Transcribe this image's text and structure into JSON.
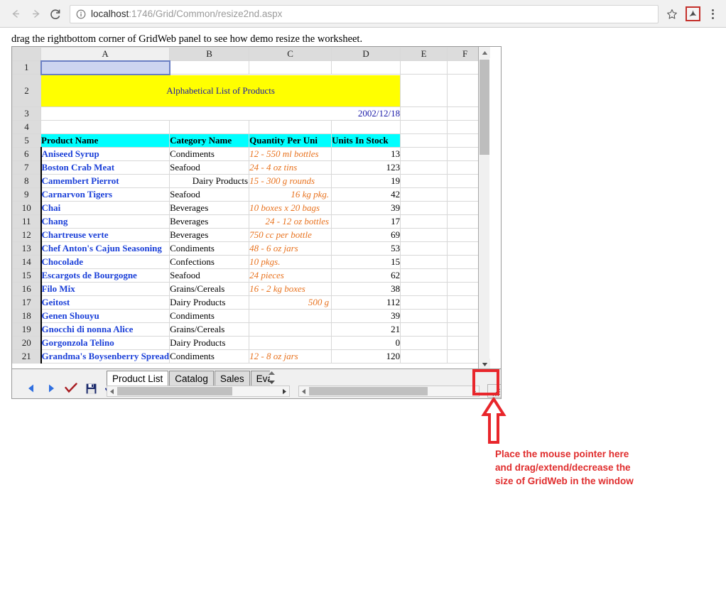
{
  "browser": {
    "back_icon": "arrow-left-icon",
    "forward_icon": "arrow-right-icon",
    "reload_icon": "reload-icon",
    "info_icon": "info-circle-icon",
    "url_host": "localhost",
    "url_path": ":1746/Grid/Common/resize2nd.aspx",
    "url_full": "localhost:1746/Grid/Common/resize2nd.aspx",
    "star_icon": "star-bookmark-icon",
    "extension_icon": "adobe-pdf-extension-icon",
    "menu_icon": "kebab-menu-icon"
  },
  "page": {
    "note": "drag the rightbottom corner of GridWeb panel to see how demo resize the worksheet."
  },
  "grid": {
    "columns": [
      "A",
      "B",
      "C",
      "D",
      "E",
      "F"
    ],
    "selected_cell": "A1",
    "title_banner": "Alphabetical List of Products",
    "date": "2002/12/18",
    "headers": [
      "Product Name",
      "Category Name",
      "Quantity Per Uni",
      "Units In Stock"
    ],
    "rows": [
      {
        "n": "6",
        "product": "Aniseed Syrup",
        "category": "Condiments",
        "cat_align": "left",
        "qty": "12 - 550 ml bottles",
        "qty_align": "left",
        "stock": "13"
      },
      {
        "n": "7",
        "product": "Boston Crab Meat",
        "category": "Seafood",
        "cat_align": "left",
        "qty": "24 - 4 oz tins",
        "qty_align": "left",
        "stock": "123"
      },
      {
        "n": "8",
        "product": "Camembert Pierrot",
        "category": "Dairy Products",
        "cat_align": "right",
        "qty": "15 - 300 g rounds",
        "qty_align": "left",
        "stock": "19"
      },
      {
        "n": "9",
        "product": "Carnarvon Tigers",
        "category": "Seafood",
        "cat_align": "left",
        "qty": "16 kg pkg.",
        "qty_align": "right",
        "stock": "42"
      },
      {
        "n": "10",
        "product": "Chai",
        "category": "Beverages",
        "cat_align": "left",
        "qty": "10 boxes x 20 bags",
        "qty_align": "left",
        "stock": "39"
      },
      {
        "n": "11",
        "product": "Chang",
        "category": "Beverages",
        "cat_align": "left",
        "qty": "24 - 12 oz bottles",
        "qty_align": "right",
        "stock": "17"
      },
      {
        "n": "12",
        "product": "Chartreuse verte",
        "category": "Beverages",
        "cat_align": "left",
        "qty": "750 cc per bottle",
        "qty_align": "left",
        "stock": "69"
      },
      {
        "n": "13",
        "product": "Chef Anton's Cajun Seasoning",
        "category": "Condiments",
        "cat_align": "left",
        "qty": "48 - 6 oz jars",
        "qty_align": "left",
        "stock": "53"
      },
      {
        "n": "14",
        "product": "Chocolade",
        "category": "Confections",
        "cat_align": "left",
        "qty": "10 pkgs.",
        "qty_align": "left",
        "stock": "15"
      },
      {
        "n": "15",
        "product": "Escargots de Bourgogne",
        "category": "Seafood",
        "cat_align": "left",
        "qty": "24 pieces",
        "qty_align": "left",
        "stock": "62"
      },
      {
        "n": "16",
        "product": "Filo Mix",
        "category": "Grains/Cereals",
        "cat_align": "left",
        "qty": "16 - 2 kg boxes",
        "qty_align": "left",
        "stock": "38"
      },
      {
        "n": "17",
        "product": "Geitost",
        "category": "Dairy Products",
        "cat_align": "left",
        "qty": "500 g",
        "qty_align": "right",
        "stock": "112"
      },
      {
        "n": "18",
        "product": "Genen Shouyu",
        "category": "Condiments",
        "cat_align": "left",
        "qty": "",
        "qty_align": "left",
        "stock": "39"
      },
      {
        "n": "19",
        "product": "Gnocchi di nonna Alice",
        "category": "Grains/Cereals",
        "cat_align": "left",
        "qty": "",
        "qty_align": "left",
        "stock": "21"
      },
      {
        "n": "20",
        "product": "Gorgonzola Telino",
        "category": "Dairy Products",
        "cat_align": "left",
        "qty": "",
        "qty_align": "left",
        "stock": "0"
      },
      {
        "n": "21",
        "product": "Grandma's Boysenberry Spread",
        "category": "Condiments",
        "cat_align": "left",
        "qty": "12 - 8 oz jars",
        "qty_align": "left",
        "stock": "120"
      }
    ]
  },
  "toolbar": {
    "prev_icon": "triangle-left-icon",
    "next_icon": "triangle-right-icon",
    "submit_icon": "checkmark-icon",
    "save_icon": "floppy-save-icon",
    "undo_icon": "undo-arrow-icon"
  },
  "tabs": [
    {
      "label": "Product List",
      "active": true
    },
    {
      "label": "Catalog",
      "active": false
    },
    {
      "label": "Sales",
      "active": false
    },
    {
      "label": "Evaluation",
      "active": false
    }
  ],
  "scrollbars": {
    "up_arrow": "scroll-up-arrow-icon",
    "down_arrow": "scroll-down-arrow-icon",
    "left_arrow": "scroll-left-arrow-icon",
    "right_arrow": "scroll-right-arrow-icon"
  },
  "resize": {
    "grip_icon": "resize-grip-icon"
  },
  "annotation": {
    "arrow_icon": "up-arrow-callout-icon",
    "line1": "Place the mouse pointer here",
    "line2": "and drag/extend/decrease the",
    "line3": "size of GridWeb in the window",
    "color": "#e02d2d"
  },
  "colors": {
    "banner_bg": "#ffff00",
    "header_bg": "#00ffff",
    "product_text": "#1a3fd8",
    "qty_text": "#e8721e",
    "selection": "#ccd4f0",
    "annotation_red": "#e02d2d"
  }
}
